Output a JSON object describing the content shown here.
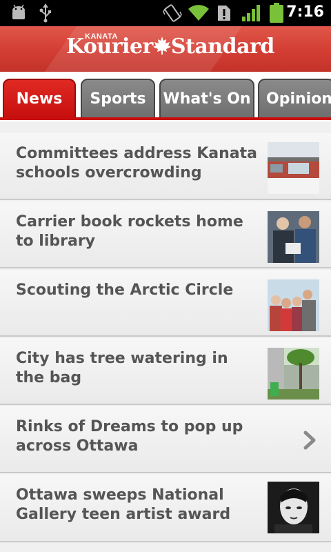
{
  "status_bar": {
    "time": "7:16",
    "icons": [
      "android-debug-icon",
      "usb-icon",
      "vibrate-icon",
      "wifi-icon",
      "sim-alert-icon",
      "signal-icon",
      "battery-icon"
    ]
  },
  "masthead": {
    "logo_small": "KANATA",
    "logo_part1": "Kourier",
    "logo_part2": "Standard",
    "color_top": "#e0574a",
    "color_bottom": "#c2332a"
  },
  "tabs": [
    {
      "label": "News",
      "active": true
    },
    {
      "label": "Sports",
      "active": false
    },
    {
      "label": "What's On",
      "active": false
    },
    {
      "label": "Opinion",
      "active": false
    }
  ],
  "accent_color": "#c70f0f",
  "articles": [
    {
      "headline": "Committees address Kanata schools overcrowding",
      "thumbnail": "school-building-photo"
    },
    {
      "headline": "Carrier book rockets home to library",
      "thumbnail": "people-with-book-photo"
    },
    {
      "headline": "Scouting the Arctic Circle",
      "thumbnail": "group-of-students-photo"
    },
    {
      "headline": "City has tree watering in the bag",
      "thumbnail": "tree-and-wall-photo"
    },
    {
      "headline": "Rinks of Dreams to pop up across Ottawa",
      "thumbnail": "chevron-right-icon"
    },
    {
      "headline": "Ottawa sweeps National Gallery teen artist award",
      "thumbnail": "portrait-artwork-photo"
    }
  ]
}
